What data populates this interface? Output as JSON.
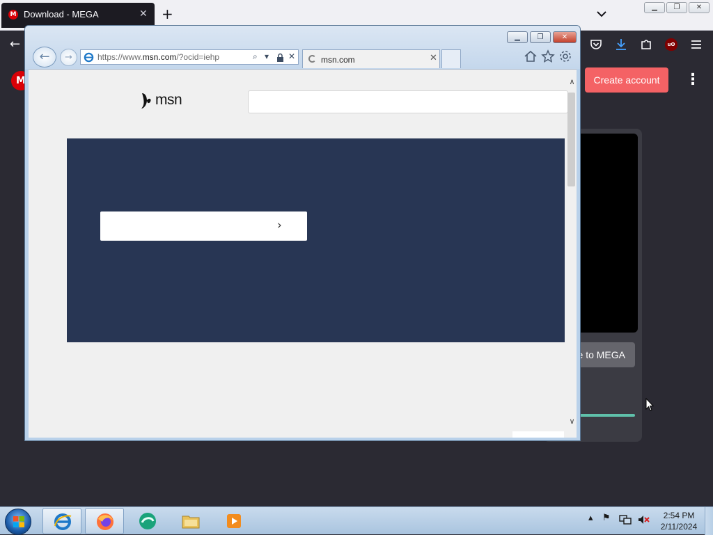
{
  "firefox": {
    "tab_title": "Download - MEGA",
    "tab_favicon_letter": "M",
    "new_tab_glyph": "+",
    "window_buttons": [
      "▁",
      "❐",
      "✕"
    ],
    "back_glyph": "←"
  },
  "mega": {
    "logo_letter": "M",
    "create_account_label": "Create account",
    "more_glyph": "⋮",
    "button_partial_label": "e to MEGA",
    "accent": "#f46265",
    "progress_color": "#5fc0aa"
  },
  "ie": {
    "caption_buttons": [
      "▁",
      "❐",
      "✕"
    ],
    "back_glyph": "←",
    "forward_glyph": "→",
    "url_prefix": "https://www.",
    "url_host": "msn.com",
    "url_suffix": "/?ocid=iehp",
    "search_glyph": "⌕",
    "dropdown_glyph": "▾",
    "lock_glyph": "🔒",
    "stop_glyph": "✕",
    "tab_label": "msn.com",
    "tab_close": "✕",
    "icons": [
      "home-icon",
      "favorites-star-icon",
      "tools-gear-icon"
    ]
  },
  "msn": {
    "logo_text": "msn",
    "chevron_glyph": "›",
    "banner_color": "#283654",
    "scroll_up": "∧",
    "scroll_down": "∨"
  },
  "taskbar": {
    "pinned": [
      "internet-explorer-icon",
      "firefox-icon",
      "app-icon",
      "file-explorer-icon",
      "media-player-icon"
    ],
    "tray_up": "▴",
    "tray_flag": "⚑",
    "time": "2:54 PM",
    "date": "2/11/2024"
  }
}
